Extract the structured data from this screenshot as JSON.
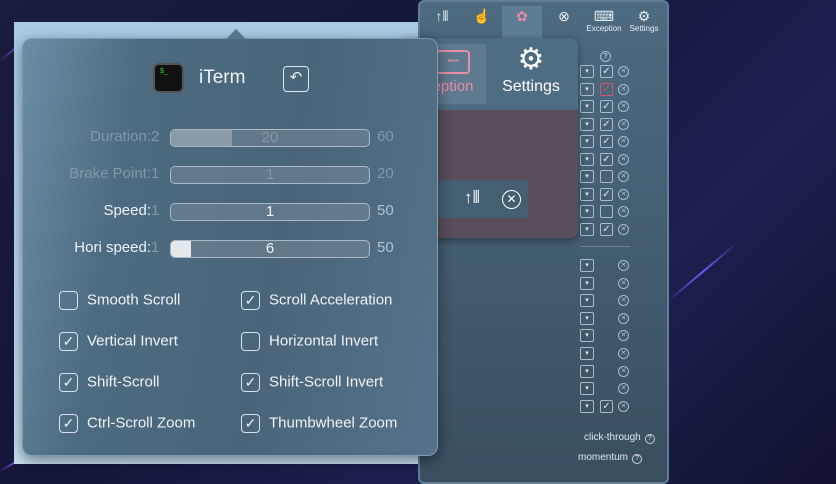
{
  "right_panel": {
    "tabs": [
      {
        "icon": "scroll-icon"
      },
      {
        "icon": "touch-icon"
      },
      {
        "icon": "apps-icon"
      },
      {
        "icon": "mouse-icon"
      },
      {
        "label": "Exception",
        "icon": "keyboard-icon"
      },
      {
        "label": "Settings",
        "icon": "gear-icon"
      }
    ],
    "help_symbol": "?",
    "upper_rows": [
      {
        "checked": true
      },
      {
        "checked": true,
        "highlight": true
      },
      {
        "checked": true
      },
      {
        "checked": true
      },
      {
        "checked": true
      },
      {
        "checked": true
      },
      {
        "checked": false
      },
      {
        "checked": true
      },
      {
        "checked": false
      },
      {
        "checked": true
      }
    ],
    "lower_rows": [
      {
        "checkbox": false
      },
      {
        "checkbox": false
      },
      {
        "checkbox": false
      },
      {
        "checkbox": false
      },
      {
        "checkbox": false
      },
      {
        "checkbox": false
      },
      {
        "checkbox": false
      },
      {
        "checkbox": false
      },
      {
        "checkbox": true,
        "checked": true
      }
    ],
    "options": [
      "click-through",
      "momentum"
    ]
  },
  "secondary_popover": {
    "tabs": [
      "eption",
      "Settings"
    ]
  },
  "popover": {
    "app_name": "iTerm",
    "sliders": [
      {
        "label": "Duration:",
        "min": "2",
        "value": "20",
        "max": "60",
        "fraction": 0.31,
        "enabled": false
      },
      {
        "label": "Brake Point:",
        "min": "1",
        "value": "1",
        "max": "20",
        "fraction": 0,
        "enabled": false
      },
      {
        "label": "Speed:",
        "min": "1",
        "value": "1",
        "max": "50",
        "fraction": 0,
        "enabled": true
      },
      {
        "label": "Hori speed:",
        "min": "1",
        "value": "6",
        "max": "50",
        "fraction": 0.1,
        "enabled": true
      }
    ],
    "checkboxes": [
      {
        "label": "Smooth Scroll",
        "checked": false
      },
      {
        "label": "Scroll Acceleration",
        "checked": true
      },
      {
        "label": "Vertical Invert",
        "checked": true
      },
      {
        "label": "Horizontal Invert",
        "checked": false
      },
      {
        "label": "Shift-Scroll",
        "checked": true
      },
      {
        "label": "Shift-Scroll Invert",
        "checked": true
      },
      {
        "label": "Ctrl-Scroll Zoom",
        "checked": true
      },
      {
        "label": "Thumbwheel Zoom",
        "checked": true
      }
    ]
  }
}
